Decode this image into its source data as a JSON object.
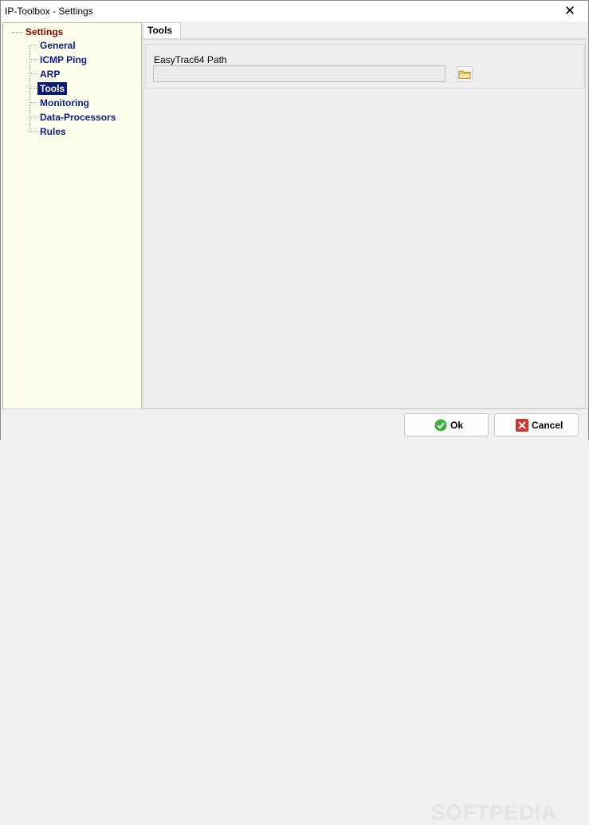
{
  "window": {
    "title": "IP-Toolbox - Settings",
    "close_glyph": "✕"
  },
  "tree": {
    "root": "Settings",
    "items": [
      {
        "label": "General",
        "selected": false
      },
      {
        "label": "ICMP Ping",
        "selected": false
      },
      {
        "label": "ARP",
        "selected": false
      },
      {
        "label": "Tools",
        "selected": true
      },
      {
        "label": "Monitoring",
        "selected": false
      },
      {
        "label": "Data-Processors",
        "selected": false
      },
      {
        "label": "Rules",
        "selected": false
      }
    ]
  },
  "tab": {
    "label": "Tools"
  },
  "tools": {
    "path_label": "EasyTrac64 Path",
    "path_value": "",
    "browse_icon": "folder-icon"
  },
  "buttons": {
    "ok": {
      "label": "Ok",
      "icon": "check-icon"
    },
    "cancel": {
      "label": "Cancel",
      "icon": "cancel-x-icon"
    }
  },
  "watermark": "SOFTPEDIA",
  "colors": {
    "tree_bg": "#fffdeb",
    "root_text": "#8b0000",
    "item_text": "#0a1e8c",
    "selected_bg": "#0a1a78"
  }
}
